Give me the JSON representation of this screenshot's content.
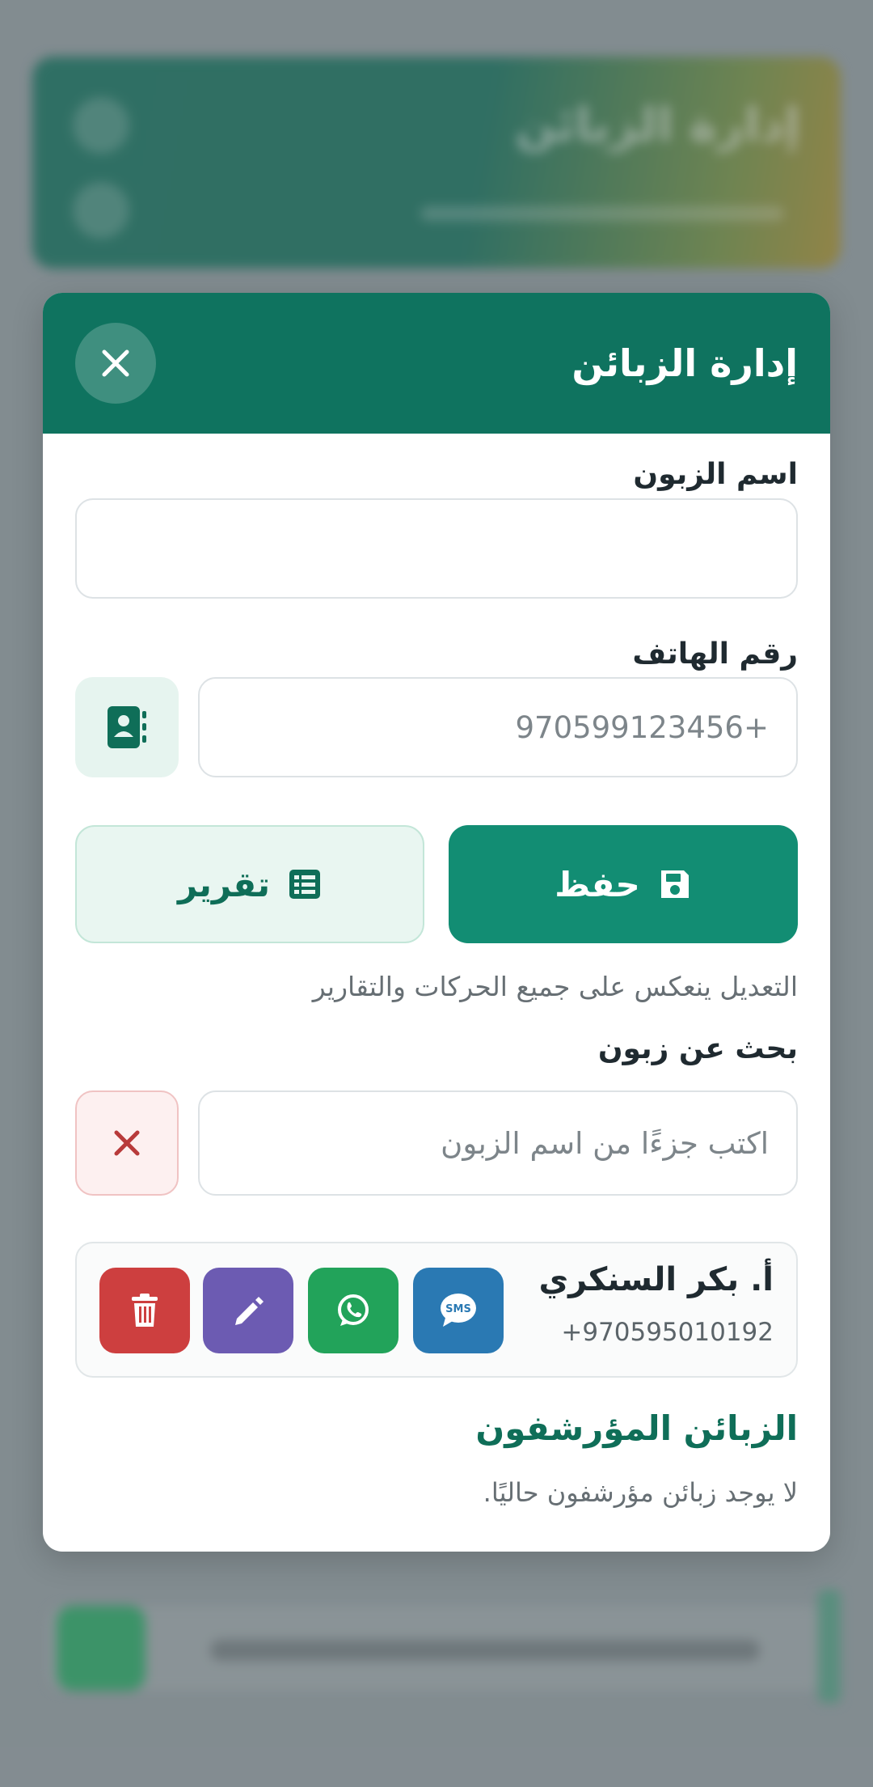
{
  "background": {
    "header_title": "إدارة الزبائن"
  },
  "modal": {
    "title": "إدارة الزبائن",
    "name_label": "اسم الزبون",
    "name_value": "",
    "phone_label": "رقم الهاتف",
    "phone_placeholder": "+970599123456",
    "save_label": "حفظ",
    "report_label": "تقرير",
    "hint": "التعديل ينعكس على جميع الحركات والتقارير",
    "search_label": "بحث عن زبون",
    "search_placeholder": "اكتب جزءًا من اسم الزبون",
    "customers": [
      {
        "name": "أ. بكر السنكري",
        "phone": "+970595010192"
      }
    ],
    "archived_title": "الزبائن المؤرشفون",
    "archived_empty": "لا يوجد زبائن مؤرشفون حاليًا."
  },
  "colors": {
    "primary": "#0f735f",
    "save": "#128d73",
    "sms": "#2a79b3",
    "whatsapp": "#22a35a",
    "edit": "#6c5bb2",
    "delete": "#cd3f3f"
  },
  "icons": [
    "close-icon",
    "contact-book-icon",
    "save-icon",
    "table-list-icon",
    "clear-icon",
    "sms-icon",
    "whatsapp-icon",
    "pencil-icon",
    "trash-icon"
  ]
}
